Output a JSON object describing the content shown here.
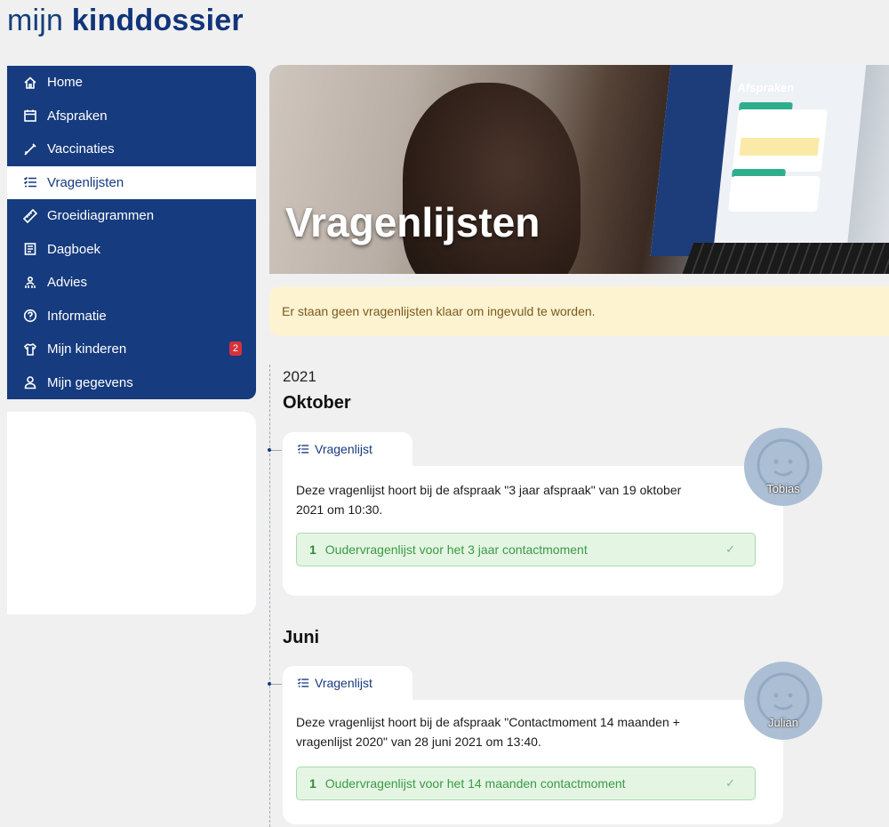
{
  "brand": {
    "light": "mijn ",
    "bold": "kinddossier"
  },
  "sidebar": {
    "items": [
      {
        "label": "Home",
        "icon": "home-icon"
      },
      {
        "label": "Afspraken",
        "icon": "calendar-icon"
      },
      {
        "label": "Vaccinaties",
        "icon": "syringe-icon"
      },
      {
        "label": "Vragenlijsten",
        "icon": "checklist-icon",
        "active": true
      },
      {
        "label": "Groeidiagrammen",
        "icon": "ruler-icon"
      },
      {
        "label": "Dagboek",
        "icon": "book-icon"
      },
      {
        "label": "Advies",
        "icon": "people-icon"
      },
      {
        "label": "Informatie",
        "icon": "question-icon"
      },
      {
        "label": "Mijn kinderen",
        "icon": "shirt-icon",
        "badge": "2"
      },
      {
        "label": "Mijn gegevens",
        "icon": "user-icon"
      }
    ]
  },
  "hero": {
    "title": "Vragenlijsten",
    "screen_heading": "Afspraken"
  },
  "notice": {
    "text": "Er staan geen vragenlijsten klaar om ingevuld te worden."
  },
  "timeline": {
    "year": "2021",
    "groups": [
      {
        "month": "Oktober",
        "card": {
          "tab_label": "Vragenlijst",
          "description": "Deze vragenlijst hoort bij de afspraak \"3 jaar afspraak\" van 19 oktober 2021 om 10:30.",
          "result_number": "1",
          "result_label": "Oudervragenlijst voor het 3 jaar contactmoment",
          "check": "✓",
          "child": "Tobias"
        }
      },
      {
        "month": "Juni",
        "card": {
          "tab_label": "Vragenlijst",
          "description": "Deze vragenlijst hoort bij de afspraak \"Contactmoment 14 maanden + vragenlijst 2020\" van 28 juni 2021 om 13:40.",
          "result_number": "1",
          "result_label": "Oudervragenlijst voor het 14 maanden contactmoment",
          "check": "✓",
          "child": "Julian"
        }
      }
    ]
  },
  "colors": {
    "nav_bg": "#163b7e",
    "notice_bg": "#fdf3d1",
    "success_bg": "#e4f5e4",
    "badge": "#d9303a"
  }
}
